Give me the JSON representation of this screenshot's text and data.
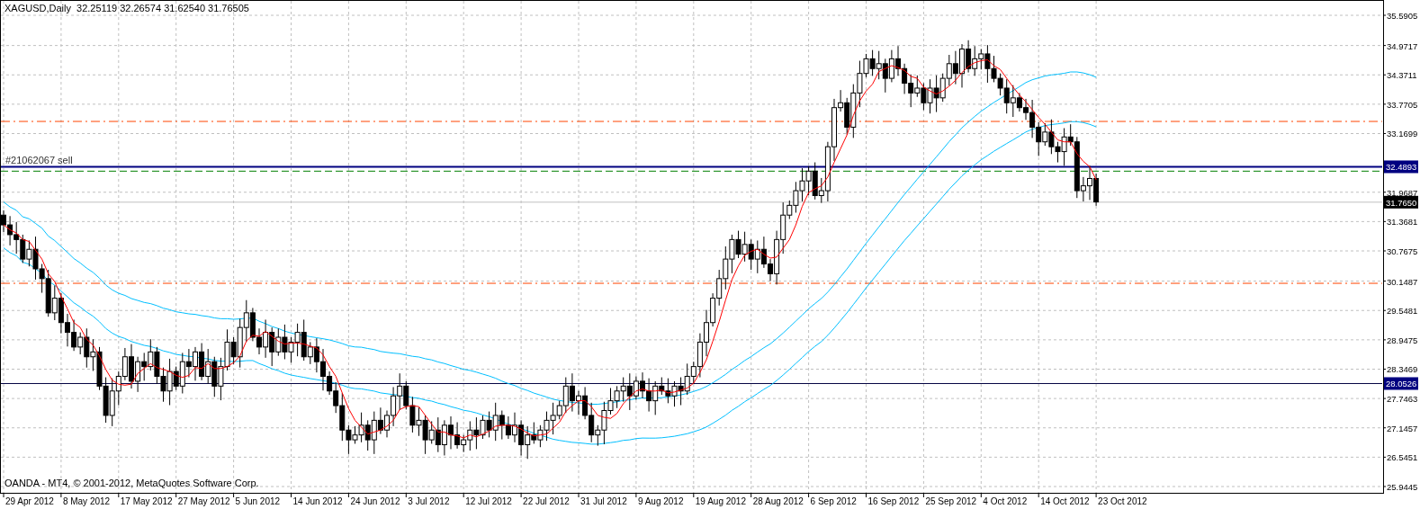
{
  "header": {
    "symbol": "XAGUSD,Daily",
    "quote": "32.25119 32.26574 31.62540 31.76505"
  },
  "order_label": "#21062067 sell",
  "price_axis": [
    "35.5905",
    "34.9717",
    "34.3711",
    "33.7705",
    "33.1699",
    "31.9687",
    "31.3681",
    "30.7675",
    "30.1487",
    "29.5481",
    "28.9475",
    "28.3469",
    "27.7463",
    "27.1457",
    "26.5451",
    "25.9445"
  ],
  "time_axis": [
    "29 Apr 2012",
    "8 May 2012",
    "17 May 2012",
    "27 May 2012",
    "5 Jun 2012",
    "14 Jun 2012",
    "24 Jun 2012",
    "3 Jul 2012",
    "12 Jul 2012",
    "22 Jul 2012",
    "31 Jul 2012",
    "9 Aug 2012",
    "19 Aug 2012",
    "28 Aug 2012",
    "6 Sep 2012",
    "16 Sep 2012",
    "25 Sep 2012",
    "4 Oct 2012",
    "14 Oct 2012",
    "23 Oct 2012"
  ],
  "price_markers": [
    {
      "text": "32.4893",
      "color": "#000080"
    },
    {
      "text": "31.7650",
      "color": "#000000"
    },
    {
      "text": "28.0526",
      "color": "#000080"
    }
  ],
  "footer": "OANDA - MT4, © 2001-2012, MetaQuotes Software Corp."
}
